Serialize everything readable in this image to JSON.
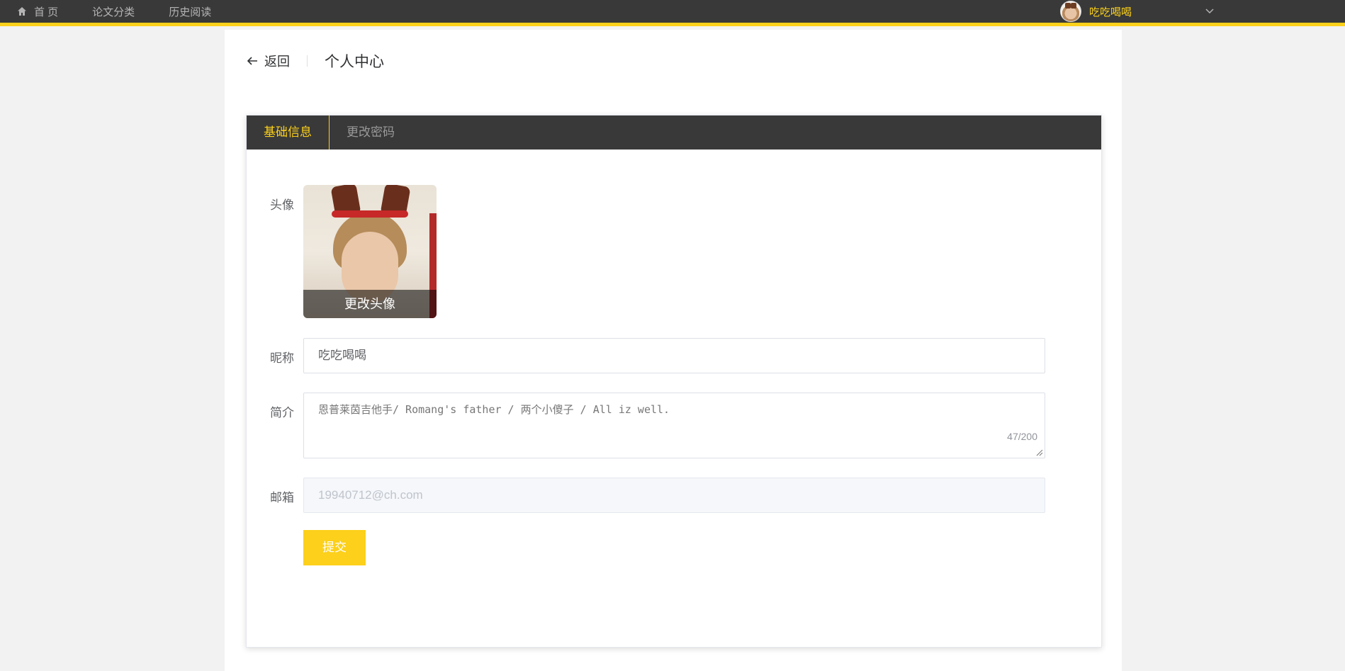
{
  "nav": {
    "home": "首 页",
    "categories": "论文分类",
    "history": "历史阅读"
  },
  "user": {
    "name": "吃吃喝喝"
  },
  "header": {
    "back": "返回",
    "title": "个人中心"
  },
  "tabs": [
    {
      "label": "基础信息",
      "active": true
    },
    {
      "label": "更改密码",
      "active": false
    }
  ],
  "form": {
    "avatar_label": "头像",
    "avatar_action": "更改头像",
    "nickname_label": "昵称",
    "nickname_value": "吃吃喝喝",
    "bio_label": "简介",
    "bio_value": "恩普莱茵吉他手/ Romang's father / 两个小傻子 / All iz well.",
    "bio_count": "47/200",
    "email_label": "邮箱",
    "email_placeholder": "19940712@ch.com",
    "submit": "提交"
  },
  "colors": {
    "accent": "#fcd01b",
    "topbar": "#393939"
  }
}
